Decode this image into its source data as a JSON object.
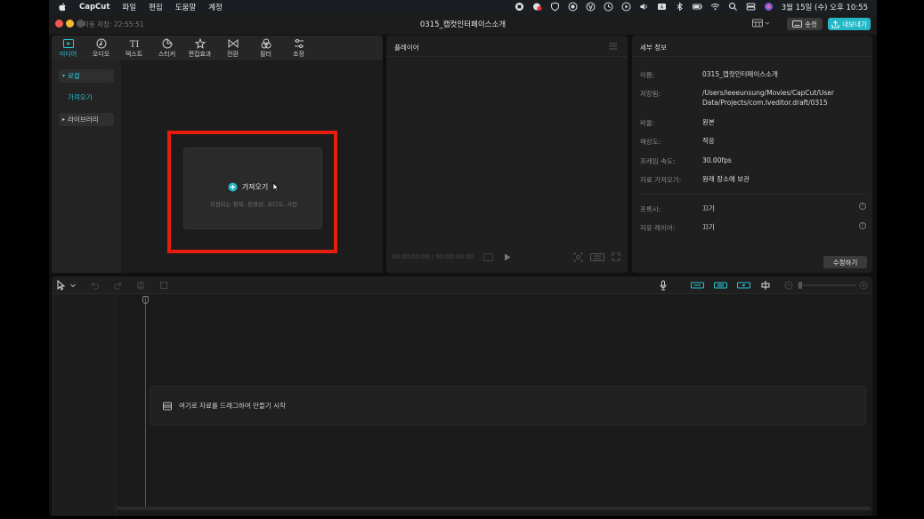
{
  "menubar": {
    "app_name": "CapCut",
    "items": [
      "파일",
      "편집",
      "도움말",
      "계정"
    ],
    "clock": "3월 15일 (수) 오후 10:55",
    "status_icons": [
      "record-icon",
      "notification-icon",
      "shield-icon",
      "cc-icon",
      "vpn-icon",
      "clock-icon",
      "play-icon",
      "volume-icon",
      "keyboard-icon",
      "bluetooth-icon",
      "battery-icon",
      "wifi-icon",
      "search-icon",
      "control-center-icon",
      "siri-icon"
    ]
  },
  "window": {
    "autosave": "자동 저장: 22:55:51",
    "title": "0315_캡컷인터페이스소개",
    "shortcut_label": "숏컷",
    "export_label": "내보내기"
  },
  "media": {
    "tabs": [
      {
        "label": "미디어",
        "icon": "media-icon",
        "active": true
      },
      {
        "label": "오디오",
        "icon": "audio-icon",
        "active": false
      },
      {
        "label": "텍스트",
        "icon": "text-icon",
        "active": false
      },
      {
        "label": "스티커",
        "icon": "sticker-icon",
        "active": false
      },
      {
        "label": "편집효과",
        "icon": "effects-icon",
        "active": false
      },
      {
        "label": "전환",
        "icon": "transition-icon",
        "active": false
      },
      {
        "label": "필터",
        "icon": "filter-icon",
        "active": false
      },
      {
        "label": "조정",
        "icon": "adjust-icon",
        "active": false
      }
    ],
    "side": {
      "local": "로컬",
      "import": "가져오기",
      "library": "라이브러리"
    },
    "import_box": {
      "label": "가져오기",
      "supported": "지원되는 항목: 동영상, 오디오, 사진"
    }
  },
  "player": {
    "title": "플레이어",
    "timecode": "00:00:00:00 / 00:00:00:00"
  },
  "details": {
    "title": "세부 정보",
    "name_label": "이름:",
    "name_value": "0315_캡컷인터페이스소개",
    "save_label": "저장됨:",
    "save_value": "/Users/leeeunsung/Movies/CapCut/User Data/Projects/com.lveditor.draft/0315",
    "ratio_label": "비율:",
    "ratio_value": "원본",
    "resolution_label": "해상도:",
    "resolution_value": "적응",
    "fps_label": "프레임 속도:",
    "fps_value": "30.00fps",
    "import_label": "자료 가져오기:",
    "import_value": "원래 장소에 보관",
    "proxy_label": "프록시:",
    "proxy_value": "끄기",
    "layer_label": "자유 레이어:",
    "layer_value": "끄기",
    "edit_button": "수정하기"
  },
  "timeline": {
    "drop_text": "여기로 자료를 드래그하여 만들기 시작"
  },
  "colors": {
    "accent": "#24b8c7",
    "highlight_box": "#e61c0d"
  }
}
